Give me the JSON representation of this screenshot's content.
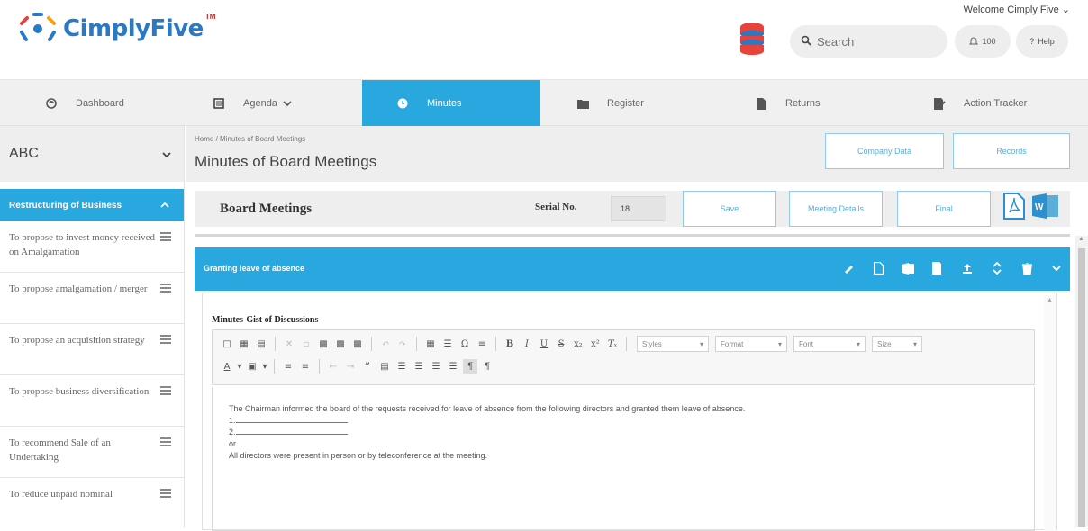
{
  "header": {
    "brand": "CimplyFive",
    "tm": "TM",
    "welcome": "Welcome Cimply Five",
    "search_placeholder": "Search",
    "notifications_count": "100",
    "help_label": "Help"
  },
  "nav": {
    "items": [
      {
        "label": "Dashboard",
        "icon": "dashboard-icon"
      },
      {
        "label": "Agenda",
        "icon": "list-icon"
      },
      {
        "label": "Minutes",
        "icon": "clock-icon"
      },
      {
        "label": "Register",
        "icon": "folder-icon"
      },
      {
        "label": "Returns",
        "icon": "document-icon"
      },
      {
        "label": "Action Tracker",
        "icon": "tracker-icon"
      }
    ],
    "active": "Minutes"
  },
  "sidebar": {
    "company": "ABC",
    "section": "Restructuring of Business",
    "items": [
      {
        "label": "To propose to invest money received on Amalgamation"
      },
      {
        "label": "To propose amalgamation / merger"
      },
      {
        "label": "To propose an acquisition strategy"
      },
      {
        "label": "To propose business diversification"
      },
      {
        "label": "To recommend Sale of an Undertaking"
      },
      {
        "label": "To reduce unpaid nominal"
      }
    ]
  },
  "page": {
    "breadcrumb": "Home  /  Minutes of Board Meetings",
    "title": "Minutes of Board Meetings",
    "company_data_label": "Company Data",
    "records_label": "Records"
  },
  "board": {
    "title": "Board Meetings",
    "serial_label": "Serial No.",
    "serial_value": "18",
    "save_label": "Save",
    "meeting_details_label": "Meeting Details",
    "final_label": "Final"
  },
  "panel": {
    "title": "Granting leave of absence",
    "gist_label": "Minutes-Gist of Discussions"
  },
  "toolbar": {
    "styles": "Styles",
    "format": "Format",
    "font": "Font",
    "size": "Size"
  },
  "editor": {
    "para1": "The Chairman informed the board of the requests received for leave of absence from the following directors and granted them leave of absence.",
    "line1": "1.",
    "line2": "2.",
    "or": "or",
    "para2": "All directors were present in person or by teleconference at the meeting."
  },
  "colors": {
    "accent": "#29a8e0",
    "brand": "#2b79c2",
    "header_bg": "#eeeeee"
  }
}
